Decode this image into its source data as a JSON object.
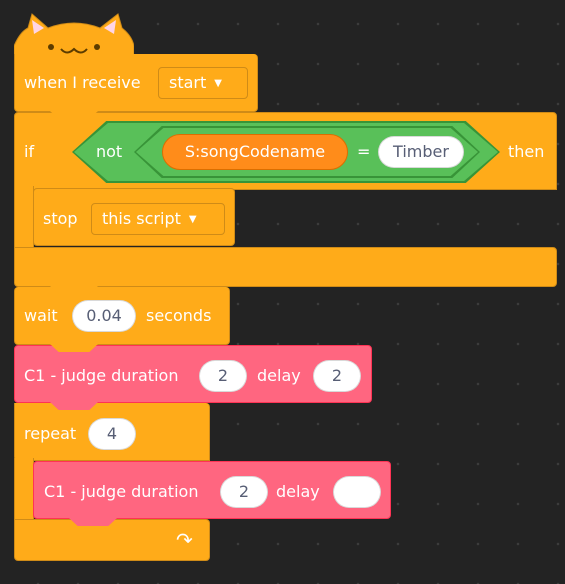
{
  "hat": {
    "label": "when I receive",
    "message": "start"
  },
  "if_block": {
    "label_if": "if",
    "label_not": "not",
    "variable": "S:songCodename",
    "operator": "=",
    "value": "Timber",
    "label_then": "then"
  },
  "stop_block": {
    "label": "stop",
    "option": "this script"
  },
  "wait_block": {
    "label_wait": "wait",
    "value": "0.04",
    "label_seconds": "seconds"
  },
  "judge_block_1": {
    "label": "C1 - judge duration",
    "duration": "2",
    "label_delay": "delay",
    "delay": "2"
  },
  "repeat_block": {
    "label": "repeat",
    "count": "4",
    "loop_arrow": "↷"
  },
  "judge_block_2": {
    "label": "C1 - judge duration",
    "duration": "2",
    "label_delay": "delay",
    "delay": ""
  },
  "colors": {
    "control": "#ffab19",
    "custom": "#ff6680",
    "operator": "#59c059",
    "variable": "#ff8c1a",
    "background": "#232323"
  }
}
